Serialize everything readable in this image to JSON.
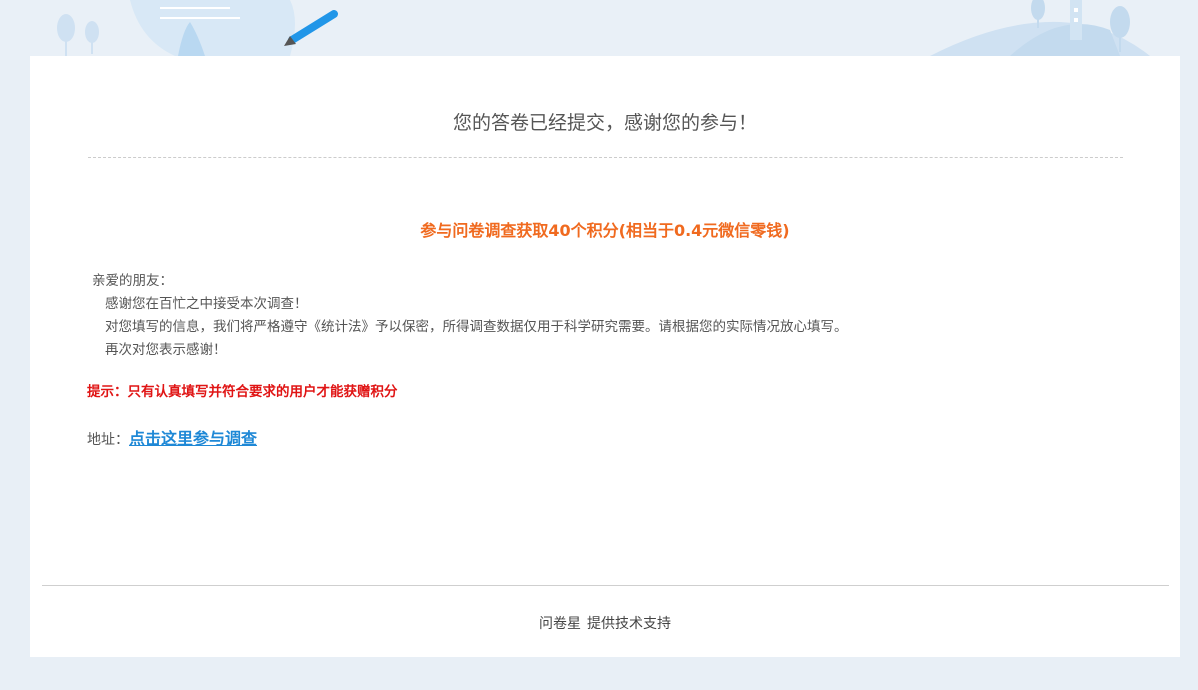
{
  "header": {
    "title": "您的答卷已经提交，感谢您的参与！"
  },
  "reward": {
    "text": "参与问卷调查获取40个积分(相当于0.4元微信零钱)"
  },
  "letter": {
    "greeting": "亲爱的朋友：",
    "lines": [
      "感谢您在百忙之中接受本次调查！",
      "对您填写的信息，我们将严格遵守《统计法》予以保密，所得调查数据仅用于科学研究需要。请根据您的实际情况放心填写。",
      "再次对您表示感谢！"
    ]
  },
  "tip": {
    "text": "提示：只有认真填写并符合要求的用户才能获赠积分"
  },
  "address": {
    "label": "地址：",
    "link_text": "点击这里参与调查"
  },
  "footer": {
    "brand": "问卷星",
    "text": "提供技术支持"
  },
  "colors": {
    "background": "#e8eff6",
    "reward": "#f06a1f",
    "tip": "#e01414",
    "link": "#1e88d6"
  }
}
